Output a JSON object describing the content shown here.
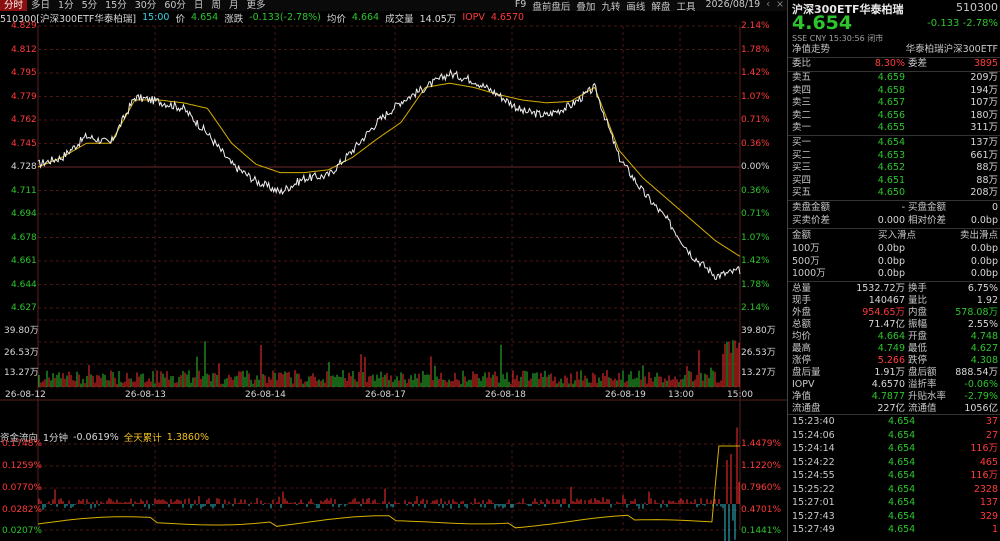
{
  "toolbar": {
    "periods": [
      "分时",
      "多日",
      "1分",
      "5分",
      "15分",
      "30分",
      "60分",
      "日",
      "周",
      "月",
      "更多"
    ],
    "active": 0,
    "right_items": [
      "F9",
      "盘前盘后",
      "叠加",
      "九转",
      "画线",
      "解盘",
      "工具"
    ],
    "date": "2026/08/19",
    "collapse_icon": "chevron-left-icon",
    "close_icon": "close-icon"
  },
  "info": {
    "name": "510300[沪深300ETF华泰柏瑞]",
    "time": "15:00",
    "price_label": "价",
    "price": "4.654",
    "change_label": "涨跌",
    "change": "-0.133(-2.78%)",
    "avg_label": "均价",
    "avg": "4.664",
    "volume_label": "成交量",
    "volume": "14.05万",
    "iopv_label": "IOPV",
    "iopv": "4.6570"
  },
  "price_axis": {
    "left": [
      "4.829",
      "4.812",
      "4.795",
      "4.779",
      "4.762",
      "4.745",
      "4.728",
      "4.711",
      "4.694",
      "4.678",
      "4.661",
      "4.644",
      "4.627"
    ],
    "right": [
      "2.14%",
      "1.78%",
      "1.42%",
      "1.07%",
      "0.71%",
      "0.36%",
      "0.00%",
      "0.36%",
      "0.71%",
      "1.07%",
      "1.42%",
      "1.78%",
      "2.14%"
    ]
  },
  "volume_axis": {
    "labels": [
      "39.80万",
      "26.53万",
      "13.27万"
    ]
  },
  "x_axis": {
    "labels": [
      "26-08-12",
      "26-08-13",
      "26-08-14",
      "26-08-17",
      "26-08-18",
      "26-08-19",
      "13:00",
      "15:00"
    ]
  },
  "fund_flow": {
    "title": "资金流向",
    "period": "1分钟",
    "value": "-0.0619%",
    "total_label": "全天累计",
    "total": "1.3860%",
    "left_axis": [
      "0.1748%",
      "0.1259%",
      "0.0770%",
      "0.0282%",
      "0.0207%"
    ],
    "right_axis": [
      "1.4479%",
      "1.1220%",
      "0.7960%",
      "0.4701%",
      "0.1441%"
    ]
  },
  "chart_data": {
    "type": "line",
    "x": [
      "26-08-12",
      "26-08-13",
      "26-08-14",
      "26-08-17",
      "26-08-18",
      "26-08-19",
      "13:00",
      "15:00"
    ],
    "series": [
      {
        "name": "价",
        "values": [
          4.73,
          4.735,
          4.75,
          4.745,
          4.778,
          4.775,
          4.77,
          4.752,
          4.73,
          4.718,
          4.71,
          4.72,
          4.722,
          4.74,
          4.76,
          4.775,
          4.785,
          4.795,
          4.79,
          4.78,
          4.768,
          4.765,
          4.772,
          4.785,
          4.735,
          4.71,
          4.69,
          4.665,
          4.65,
          4.654
        ]
      },
      {
        "name": "均价",
        "values": [
          4.728,
          4.735,
          4.745,
          4.745,
          4.776,
          4.776,
          4.774,
          4.77,
          4.745,
          4.73,
          4.724,
          4.724,
          4.726,
          4.735,
          4.748,
          4.76,
          4.785,
          4.788,
          4.785,
          4.78,
          4.776,
          4.774,
          4.775,
          4.785,
          4.74,
          4.72,
          4.705,
          4.69,
          4.675,
          4.664
        ]
      }
    ],
    "ylim": [
      4.627,
      4.829
    ],
    "colors": {
      "price": "#f0f0f0",
      "avg": "#d8b000",
      "up": "#ff3030",
      "down": "#30c0d0",
      "grid": "#4a1515"
    }
  },
  "quote": {
    "name": "沪深300ETF华泰柏瑞",
    "code": "510300",
    "price": "4.654",
    "change": "-0.133",
    "change_pct": "-2.78%",
    "meta": "SSE  CNY  15:30:56  闭市",
    "trend_label": "净值走势",
    "issuer": "华泰柏瑞沪深300ETF",
    "ratio_label": "委比",
    "ratio_value": "8.30%",
    "diff_label": "委差",
    "diff_value": "3895",
    "asks": [
      {
        "label": "卖五",
        "price": "4.659",
        "vol": "209万"
      },
      {
        "label": "卖四",
        "price": "4.658",
        "vol": "194万"
      },
      {
        "label": "卖三",
        "price": "4.657",
        "vol": "107万"
      },
      {
        "label": "卖二",
        "price": "4.656",
        "vol": "180万"
      },
      {
        "label": "卖一",
        "price": "4.655",
        "vol": "311万"
      }
    ],
    "bids": [
      {
        "label": "买一",
        "price": "4.654",
        "vol": "137万"
      },
      {
        "label": "买二",
        "price": "4.653",
        "vol": "661万"
      },
      {
        "label": "买三",
        "price": "4.652",
        "vol": "88万"
      },
      {
        "label": "买四",
        "price": "4.651",
        "vol": "88万"
      },
      {
        "label": "买五",
        "price": "4.650",
        "vol": "208万"
      }
    ],
    "amounts": [
      {
        "a": "卖盘金额",
        "b": "-",
        "c": "买盘金额",
        "d": "0"
      },
      {
        "a": "买卖价差",
        "b": "0.000",
        "c": "相对价差",
        "d": "0.0bp"
      }
    ],
    "slip_header": {
      "a": "金额",
      "b": "买入滑点",
      "d": "卖出滑点"
    },
    "slips": [
      {
        "a": "100万",
        "b": "0.0bp",
        "d": "0.0bp"
      },
      {
        "a": "500万",
        "b": "0.0bp",
        "d": "0.0bp"
      },
      {
        "a": "1000万",
        "b": "0.0bp",
        "d": "0.0bp"
      }
    ],
    "stats": [
      {
        "a": "总量",
        "b": "1532.72万",
        "c": "换手",
        "d": "6.75%"
      },
      {
        "a": "现手",
        "b": "140467",
        "c": "量比",
        "d": "1.92"
      },
      {
        "a": "外盘",
        "b": "954.65万",
        "c": "内盘",
        "d": "578.08万"
      },
      {
        "a": "总额",
        "b": "71.47亿",
        "c": "振幅",
        "d": "2.55%"
      },
      {
        "a": "均价",
        "b": "4.664",
        "c": "开盘",
        "d": "4.748"
      },
      {
        "a": "最高",
        "b": "4.749",
        "c": "最低",
        "d": "4.627"
      },
      {
        "a": "涨停",
        "b": "5.266",
        "c": "跌停",
        "d": "4.308"
      },
      {
        "a": "盘后量",
        "b": "1.91万",
        "c": "盘后额",
        "d": "888.54万"
      },
      {
        "a": "IOPV",
        "b": "4.6570",
        "c": "溢折率",
        "d": "-0.06%"
      },
      {
        "a": "净值",
        "b": "4.7877",
        "c": "升贴水率",
        "d": "-2.79%"
      },
      {
        "a": "流通盘",
        "b": "227亿",
        "c": "流通值",
        "d": "1056亿"
      }
    ],
    "trades": [
      {
        "t": "15:23:40",
        "p": "4.654",
        "v": "37"
      },
      {
        "t": "15:24:06",
        "p": "4.654",
        "v": "27"
      },
      {
        "t": "15:24:14",
        "p": "4.654",
        "v": "116万"
      },
      {
        "t": "15:24:22",
        "p": "4.654",
        "v": "465"
      },
      {
        "t": "15:24:55",
        "p": "4.654",
        "v": "116万"
      },
      {
        "t": "15:25:22",
        "p": "4.654",
        "v": "2328"
      },
      {
        "t": "15:27:01",
        "p": "4.654",
        "v": "137"
      },
      {
        "t": "15:27:43",
        "p": "4.654",
        "v": "329"
      },
      {
        "t": "15:27:49",
        "p": "4.654",
        "v": "1"
      }
    ]
  }
}
